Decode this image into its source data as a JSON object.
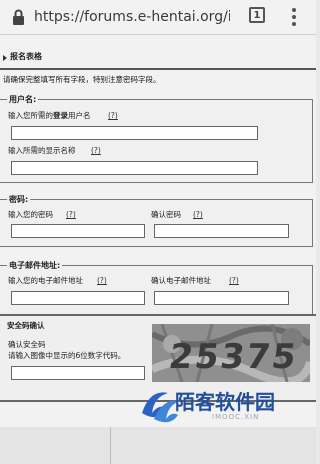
{
  "browser": {
    "url": "https://forums.e-hentai.org/ir",
    "tab_count": "1"
  },
  "page": {
    "section_title": "报名表格",
    "notice": "请确保完整填写所有字段，特别注意密码字段。"
  },
  "username": {
    "legend": "用户名:",
    "login_label_pre": "输入您所需的",
    "login_label_bold": "登录",
    "login_label_post": "用户名",
    "login_help": "(?)",
    "display_label": "输入所需的显示名称",
    "display_help": "(?)",
    "login_value": "",
    "display_value": ""
  },
  "password": {
    "legend": "密码:",
    "pass_label": "输入您的密码",
    "pass_help": "(?)",
    "confirm_label": "确认密码",
    "confirm_help": "(?)"
  },
  "email": {
    "legend": "电子邮件地址:",
    "email_label": "输入您的电子邮件地址",
    "email_help": "(?)",
    "confirm_label": "确认电子邮件地址",
    "confirm_help": "(?)"
  },
  "captcha": {
    "legend": "安全码确认",
    "label1": "确认安全码",
    "label2": "请输入图像中显示的6位数字代码。",
    "image_text": "25375"
  },
  "watermark": {
    "brand": "陌客软件园",
    "sub": "IMOOC.XIN"
  },
  "colors": {
    "watermark_blue": "#244f9a",
    "chrome_bg": "#f2f2f2"
  }
}
